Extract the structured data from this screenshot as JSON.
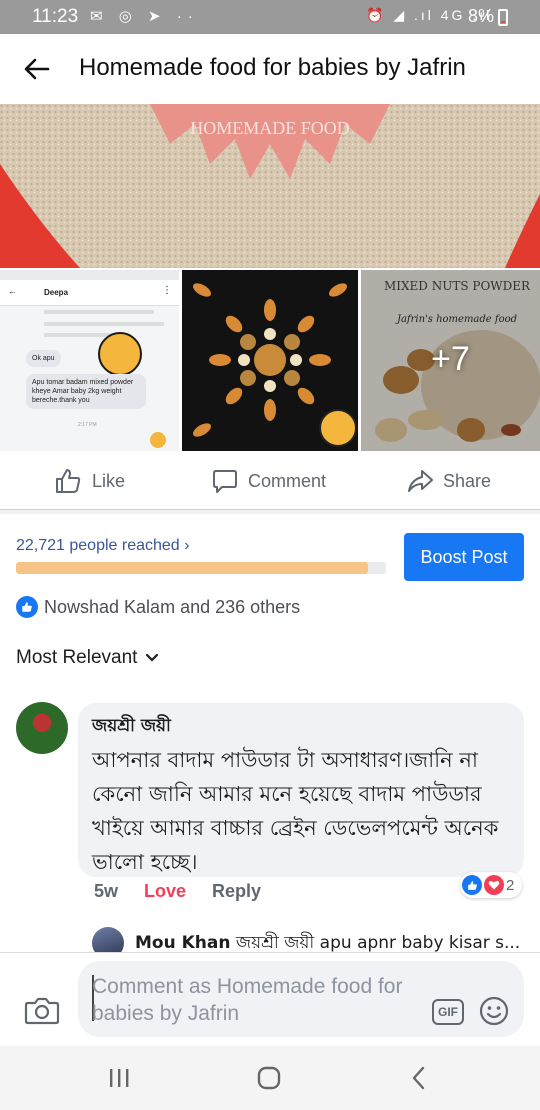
{
  "status_bar": {
    "time": "11:23",
    "left_icons": "✉ ◎ ➤ ··",
    "right_icons": "⏰ ◢ .ıl 4G .ıl",
    "battery": "8%"
  },
  "header": {
    "title": "Homemade food for babies by Jafrin"
  },
  "photos": {
    "hero_logo_text": "HOMEMADE FOOD",
    "chat_name": "Deepa",
    "chat_reply": "Ok apu",
    "chat_message": "Apu tomar badam mixed powder kheye Amar baby 2kg weight bereche.thank you",
    "chat_time": "2:17 PM",
    "more_count": "+7",
    "thumb3_title": "MIXED NUTS POWDER",
    "thumb3_sub": "Jafrin's homemade food"
  },
  "actions": {
    "like": "Like",
    "comment": "Comment",
    "share": "Share"
  },
  "reach": {
    "text": "22,721 people reached",
    "chevron": "›",
    "progress": 0.95,
    "boost": "Boost Post"
  },
  "reactions": {
    "text": "Nowshad Kalam and 236 others"
  },
  "sort": {
    "label": "Most Relevant"
  },
  "comment": {
    "author": "জয়শ্রী জয়ী",
    "text": "আপনার বাদাম পাউডার টা অসাধারণ।জানি না কেনো জানি আমার মনে হয়েছে বাদাম পাউডার খাইয়ে আমার বাচ্চার ব্রেইন ডেভেলপমেন্ট অনেক ভালো হচ্ছে।",
    "time": "5w",
    "love": "Love",
    "reply": "Reply",
    "reaction_count": "2"
  },
  "reply": {
    "author": "Mou Khan",
    "text": "জয়শ্রী জয়ী apu apnr baby kisar s..."
  },
  "composer": {
    "placeholder": "Comment as Homemade food for babies by Jafrin",
    "gif": "GIF"
  },
  "colors": {
    "brand_blue": "#1877f2",
    "link_blue": "#385898",
    "love_red": "#f33e58",
    "progress_orange": "#f7c488"
  }
}
